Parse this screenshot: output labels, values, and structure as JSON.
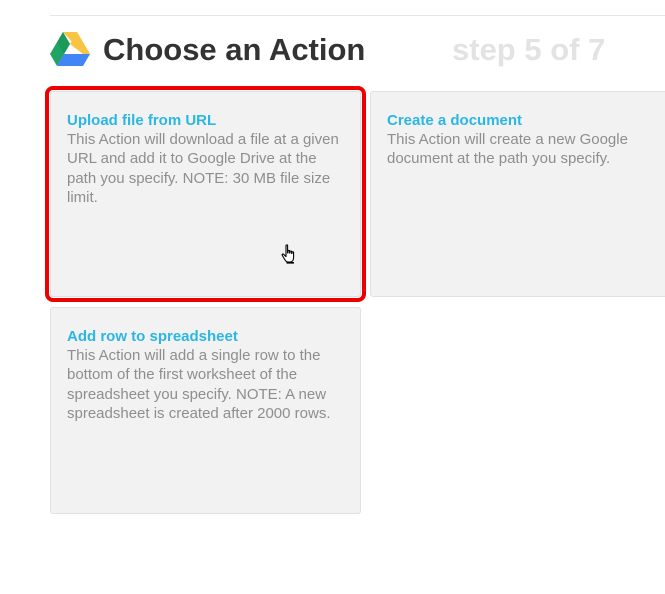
{
  "header": {
    "title": "Choose an Action",
    "step": "step 5 of 7",
    "icon": "google-drive-icon"
  },
  "colors": {
    "card_title": "#2bb7e3",
    "card_text": "#8e8e8e",
    "card_bg": "#f2f2f2",
    "selection": "#ee0000",
    "step_text": "#e3e3e3"
  },
  "actions": [
    {
      "title": "Upload file from URL",
      "description": "This Action will download a file at a given URL and add it to Google Drive at the path you specify. NOTE: 30 MB file size limit.",
      "selected": true
    },
    {
      "title": "Create a document",
      "description": "This Action will create a new Google document at the path you specify.",
      "selected": false
    },
    {
      "title": "Add row to spreadsheet",
      "description": "This Action will add a single row to the bottom of the first worksheet of the spreadsheet you specify. NOTE: A new spreadsheet is created after 2000 rows.",
      "selected": false
    }
  ]
}
